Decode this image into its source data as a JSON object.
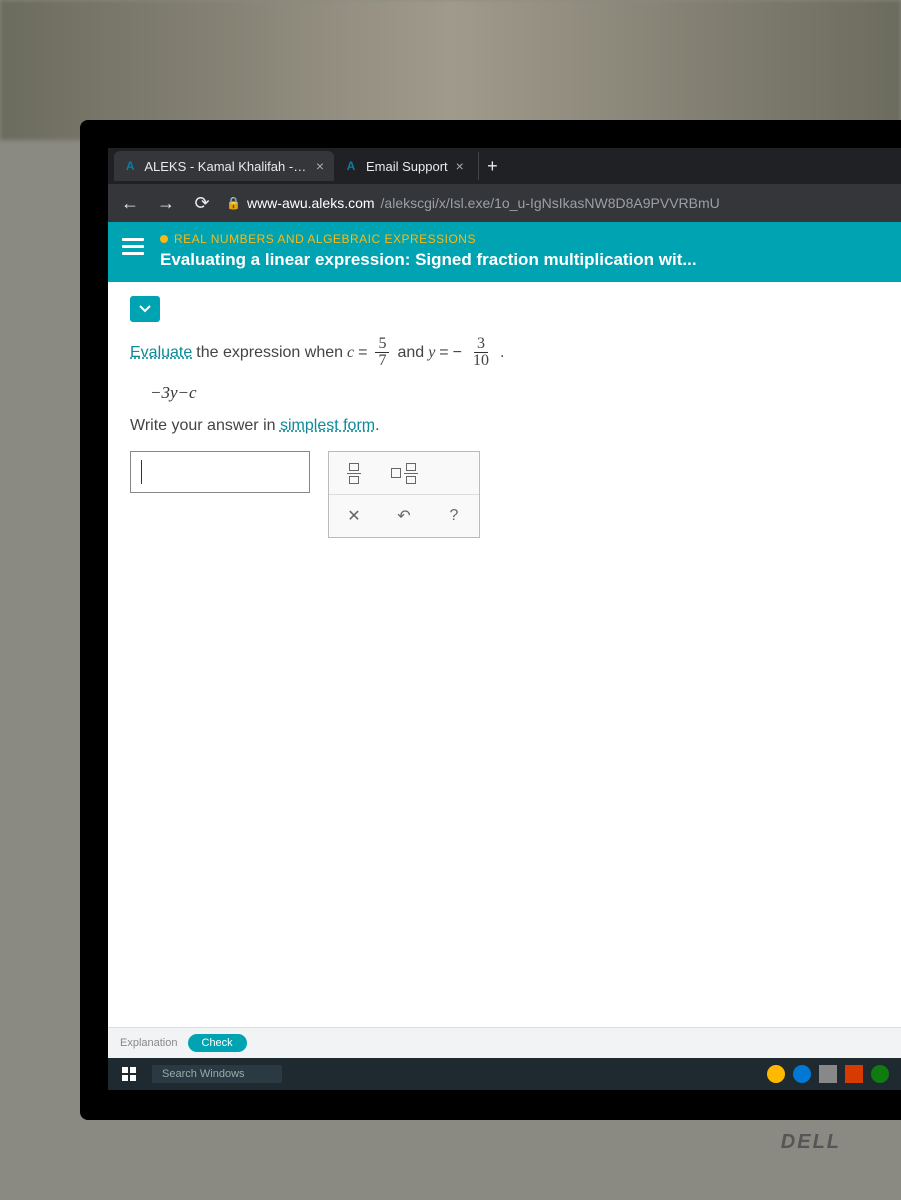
{
  "tabs": [
    {
      "favicon": "A",
      "title": "ALEKS - Kamal Khalifah - Learn"
    },
    {
      "favicon": "A",
      "title": "Email Support"
    }
  ],
  "url": {
    "host": "www-awu.aleks.com",
    "path": "/alekscgi/x/Isl.exe/1o_u-IgNsIkasNW8D8A9PVVRBmU"
  },
  "header": {
    "breadcrumb": "REAL NUMBERS AND ALGEBRAIC EXPRESSIONS",
    "title": "Evaluating a linear expression: Signed fraction multiplication wit..."
  },
  "problem": {
    "term_evaluate": "Evaluate",
    "text1": " the expression when ",
    "var_c": "c",
    "eq": " = ",
    "frac1_num": "5",
    "frac1_den": "7",
    "text2": " and ",
    "var_y": "y",
    "eq2": " = ",
    "neg": "−",
    "frac2_num": "3",
    "frac2_den": "10",
    "period": ".",
    "expression": "−3y−c",
    "instruction_pre": "Write your answer in ",
    "term_simplest": "simplest form",
    "instruction_post": "."
  },
  "tools": {
    "clear": "✕",
    "undo": "↶",
    "help": "?"
  },
  "footer": {
    "explanation": "Explanation",
    "check": "Check"
  },
  "taskbar": {
    "search": "Search Windows"
  },
  "monitor_brand": "DELL"
}
